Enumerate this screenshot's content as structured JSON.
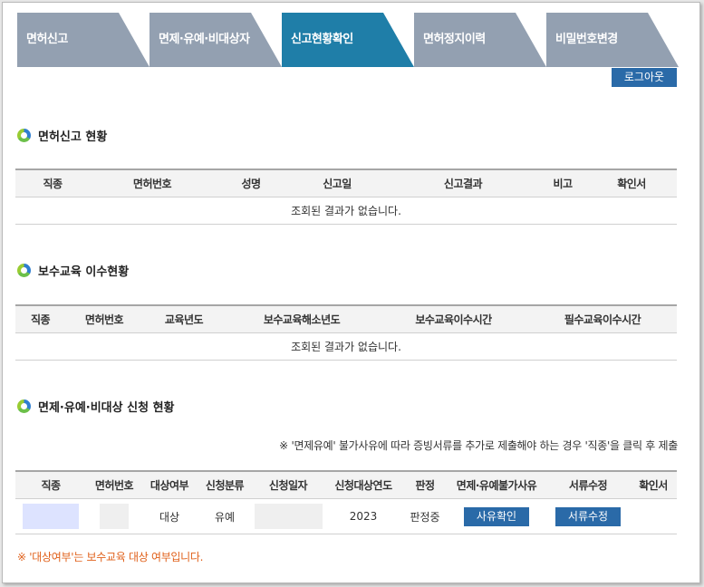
{
  "tabs": [
    {
      "label": "면허신고",
      "active": false
    },
    {
      "label": "면제·유예·비대상자",
      "active": false
    },
    {
      "label": "신고현황확인",
      "active": true
    },
    {
      "label": "면허정지이력",
      "active": false
    },
    {
      "label": "비밀번호변경",
      "active": false
    }
  ],
  "logout_label": "로그아웃",
  "section1": {
    "title": "면허신고 현황",
    "headers": [
      "직종",
      "면허번호",
      "성명",
      "신고일",
      "신고결과",
      "비고",
      "확인서"
    ],
    "empty_text": "조회된 결과가 없습니다."
  },
  "section2": {
    "title": "보수교육 이수현황",
    "headers": [
      "직종",
      "면허번호",
      "교육년도",
      "보수교육해소년도",
      "보수교육이수시간",
      "필수교육이수시간"
    ],
    "empty_text": "조회된 결과가 없습니다."
  },
  "section3": {
    "title": "면제·유예·비대상 신청 현황",
    "notice": "※ '면제유예' 불가사유에 따라 증빙서류를 추가로 제출해야 하는 경우 '직종'을 클릭 후 제출",
    "headers": [
      "직종",
      "면허번호",
      "대상여부",
      "신청분류",
      "신청일자",
      "신청대상연도",
      "판정",
      "면제·유예불가사유",
      "서류수정",
      "확인서"
    ],
    "row": {
      "target": "대상",
      "category": "유예",
      "year": "2023",
      "decision": "판정중",
      "reason_btn": "사유확인",
      "edit_btn": "서류수정"
    }
  },
  "footer_note": "※ '대상여부'는 보수교육 대상 여부입니다.",
  "colors": {
    "tab": "#93a0b1",
    "tab_active": "#1f7ea8",
    "button": "#2a6aa8",
    "footer_note": "#e0601a",
    "mask_blue": "#dde3ff",
    "mask_gray": "#efefef"
  }
}
